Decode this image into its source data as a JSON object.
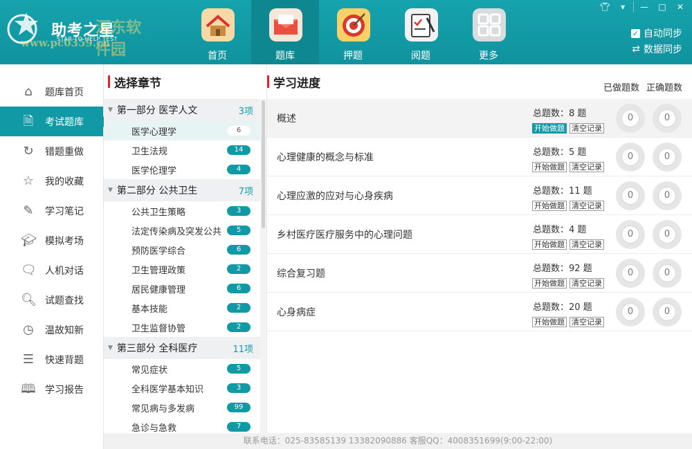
{
  "header": {
    "app_name": "助考之星",
    "tagline": "STAR TO HELP TEST",
    "watermark_url": "www.pc0359.cn",
    "watermark_text": "河东软件园",
    "nav": [
      {
        "label": "首页",
        "icon": "home-icon"
      },
      {
        "label": "题库",
        "icon": "mail-icon"
      },
      {
        "label": "押题",
        "icon": "target-icon"
      },
      {
        "label": "阅题",
        "icon": "clipboard-icon"
      },
      {
        "label": "更多",
        "icon": "grid-icon"
      }
    ],
    "auto_sync": "自动同步",
    "data_sync": "数据同步"
  },
  "leftnav": [
    {
      "label": "题库首页",
      "icon": "home-outline-icon"
    },
    {
      "label": "考试题库",
      "icon": "document-icon"
    },
    {
      "label": "错题重做",
      "icon": "refresh-icon"
    },
    {
      "label": "我的收藏",
      "icon": "star-icon"
    },
    {
      "label": "学习笔记",
      "icon": "edit-icon"
    },
    {
      "label": "模拟考场",
      "icon": "grad-cap-icon"
    },
    {
      "label": "人机对话",
      "icon": "chat-icon"
    },
    {
      "label": "试题查找",
      "icon": "search-icon"
    },
    {
      "label": "温故知新",
      "icon": "clock-icon"
    },
    {
      "label": "快速背题",
      "icon": "list-icon"
    },
    {
      "label": "学习报告",
      "icon": "book-icon"
    }
  ],
  "chapters": {
    "title": "选择章节",
    "parts": [
      {
        "name": "第一部分 医学人文",
        "count": "3项",
        "items": [
          {
            "label": "医学心理学",
            "count": "6"
          },
          {
            "label": "卫生法规",
            "count": "14"
          },
          {
            "label": "医学伦理学",
            "count": "4"
          }
        ]
      },
      {
        "name": "第二部分 公共卫生",
        "count": "7项",
        "items": [
          {
            "label": "公共卫生策略",
            "count": "3"
          },
          {
            "label": "法定传染病及突发公共",
            "count": "5"
          },
          {
            "label": "预防医学综合",
            "count": "6"
          },
          {
            "label": "卫生管理政策",
            "count": "2"
          },
          {
            "label": "居民健康管理",
            "count": "6"
          },
          {
            "label": "基本技能",
            "count": "2"
          },
          {
            "label": "卫生监督协管",
            "count": "2"
          }
        ]
      },
      {
        "name": "第三部分 全科医疗",
        "count": "11项",
        "items": [
          {
            "label": "常见症状",
            "count": "5"
          },
          {
            "label": "全科医学基本知识",
            "count": "3"
          },
          {
            "label": "常见病与多发病",
            "count": "99"
          },
          {
            "label": "急诊与急救",
            "count": "7"
          }
        ]
      }
    ]
  },
  "progress": {
    "title": "学习进度",
    "done_label": "已做题数",
    "correct_label": "正确题数",
    "start_label": "开始做题",
    "clear_label": "清空记录",
    "rows": [
      {
        "name": "概述",
        "total": "总题数：8 题",
        "done": "0",
        "correct": "0"
      },
      {
        "name": "心理健康的概念与标准",
        "total": "总题数：5 题",
        "done": "0",
        "correct": "0"
      },
      {
        "name": "心理应激的应对与心身疾病",
        "total": "总题数：11 题",
        "done": "0",
        "correct": "0"
      },
      {
        "name": "乡村医疗医疗服务中的心理问题",
        "total": "总题数：4 题",
        "done": "0",
        "correct": "0"
      },
      {
        "name": "综合复习题",
        "total": "总题数：92 题",
        "done": "0",
        "correct": "0"
      },
      {
        "name": "心身病症",
        "total": "总题数：20 题",
        "done": "0",
        "correct": "0"
      }
    ]
  },
  "footer": "联系电话：025-83585139  13382090886  客服QQ：4008351699(9:00-22:00)"
}
